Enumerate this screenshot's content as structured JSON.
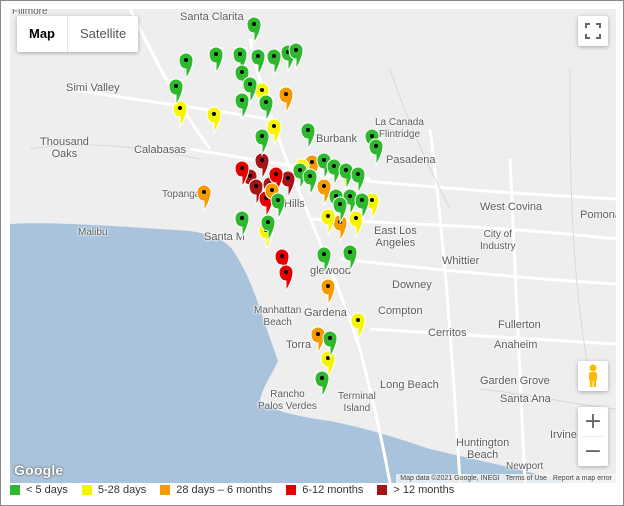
{
  "map": {
    "type_toggle": {
      "map_label": "Map",
      "satellite_label": "Satellite",
      "selected": "Map"
    },
    "controls": {
      "zoom_in": "+",
      "zoom_out": "−"
    },
    "google_logo": "Google",
    "attribution": {
      "data": "Map data ©2021 Google, INEGI",
      "terms": "Terms of Use",
      "report": "Report a map error"
    },
    "places": [
      {
        "name": "Fillmore",
        "cls": "small"
      },
      {
        "name": "Santa Clarita",
        "cls": ""
      },
      {
        "name": "Simi Valley",
        "cls": ""
      },
      {
        "name": "Thousand\nOaks",
        "cls": ""
      },
      {
        "name": "Calabasas",
        "cls": ""
      },
      {
        "name": "Burbank",
        "cls": ""
      },
      {
        "name": "La Canada\nFlintridge",
        "cls": "small"
      },
      {
        "name": "Pasadena",
        "cls": ""
      },
      {
        "name": "Topanga",
        "cls": "small"
      },
      {
        "name": "Malibu",
        "cls": "small"
      },
      {
        "name": "Hills",
        "cls": ""
      },
      {
        "name": "Santa M",
        "cls": ""
      },
      {
        "name": "East Los\nAngeles",
        "cls": ""
      },
      {
        "name": "West Covina",
        "cls": ""
      },
      {
        "name": "Pomona",
        "cls": ""
      },
      {
        "name": "City of\nIndustry",
        "cls": "small"
      },
      {
        "name": "Whittier",
        "cls": ""
      },
      {
        "name": "Downey",
        "cls": ""
      },
      {
        "name": "glewood",
        "cls": ""
      },
      {
        "name": "Manhattan\nBeach",
        "cls": "small"
      },
      {
        "name": "Gardena",
        "cls": ""
      },
      {
        "name": "Compton",
        "cls": ""
      },
      {
        "name": "Cerritos",
        "cls": ""
      },
      {
        "name": "Fullerton",
        "cls": ""
      },
      {
        "name": "Anaheim",
        "cls": ""
      },
      {
        "name": "Torra",
        "cls": ""
      },
      {
        "name": "Long Beach",
        "cls": ""
      },
      {
        "name": "Garden Grove",
        "cls": ""
      },
      {
        "name": "Rancho\nPalos Verdes",
        "cls": "small"
      },
      {
        "name": "Terminal\nIsland",
        "cls": "small"
      },
      {
        "name": "Santa Ana",
        "cls": ""
      },
      {
        "name": "Irvine",
        "cls": ""
      },
      {
        "name": "Huntington\nBeach",
        "cls": ""
      },
      {
        "name": "Newport",
        "cls": "small"
      }
    ],
    "pins": [
      {
        "c": "g",
        "n": 16
      },
      {
        "c": "g",
        "n": 18
      },
      {
        "c": "g",
        "n": 14
      },
      {
        "c": "y",
        "n": 6
      },
      {
        "c": "o",
        "n": 4
      },
      {
        "c": "r",
        "n": 3
      },
      {
        "c": "d",
        "n": 3
      }
    ]
  },
  "legend": [
    {
      "label": "< 5 days",
      "color": "#2db82d"
    },
    {
      "label": "5-28 days",
      "color": "#f5f500"
    },
    {
      "label": "28 days – 6 months",
      "color": "#f59a00"
    },
    {
      "label": "6-12 months",
      "color": "#e50000"
    },
    {
      "label": "> 12 months",
      "color": "#a51515"
    }
  ]
}
